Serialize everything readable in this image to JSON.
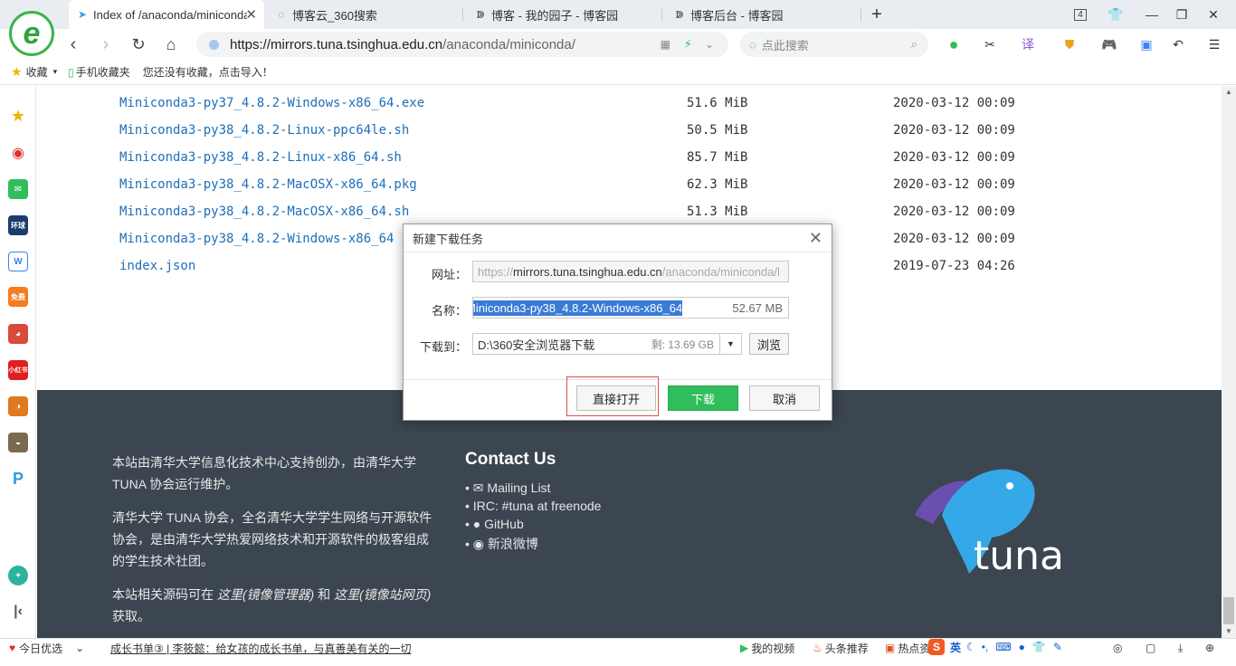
{
  "browser": {
    "tabs": [
      {
        "label": "Index of /anaconda/miniconda/",
        "active": true
      },
      {
        "label": "博客云_360搜索",
        "active": false
      },
      {
        "label": "博客 - 我的园子 - 博客园",
        "active": false
      },
      {
        "label": "博客后台 - 博客园",
        "active": false
      }
    ],
    "new_tab": "+",
    "tab_count": "4",
    "url_host": "https://mirrors.tuna.tsinghua.edu.cn",
    "url_path": "/anaconda/miniconda/",
    "search_placeholder": "点此搜索"
  },
  "bookmarks": {
    "favorites_label": "收藏",
    "mobile_label": "手机收藏夹",
    "empty_hint": "您还没有收藏，点击导入！"
  },
  "files": [
    {
      "name": "Miniconda3-py37_4.8.2-Windows-x86_64.exe",
      "size": "51.6 MiB",
      "date": "2020-03-12 00:09"
    },
    {
      "name": "Miniconda3-py38_4.8.2-Linux-ppc64le.sh",
      "size": "50.5 MiB",
      "date": "2020-03-12 00:09"
    },
    {
      "name": "Miniconda3-py38_4.8.2-Linux-x86_64.sh",
      "size": "85.7 MiB",
      "date": "2020-03-12 00:09"
    },
    {
      "name": "Miniconda3-py38_4.8.2-MacOSX-x86_64.pkg",
      "size": "62.3 MiB",
      "date": "2020-03-12 00:09"
    },
    {
      "name": "Miniconda3-py38_4.8.2-MacOSX-x86_64.sh",
      "size": "51.3 MiB",
      "date": "2020-03-12 00:09"
    },
    {
      "name": "Miniconda3-py38_4.8.2-Windows-x86_64",
      "size": "",
      "date": "2020-03-12 00:09"
    },
    {
      "name": "index.json",
      "size": "",
      "date": "2019-07-23 04:26"
    }
  ],
  "footer": {
    "para1": "本站由清华大学信息化技术中心支持创办，由清华大学 TUNA 协会运行维护。",
    "para2": "清华大学 TUNA 协会，全名清华大学学生网络与开源软件协会，是由清华大学热爱网络技术和开源软件的极客组成的学生技术社团。",
    "para3_prefix": "本站相关源码可在",
    "para3_link1": "这里(镜像管理器)",
    "para3_mid": "和",
    "para3_link2": "这里(镜像站网页)",
    "para3_suffix": "获取。",
    "contact_title": "Contact Us",
    "contacts": [
      "Mailing List",
      "IRC: #tuna at freenode",
      "GitHub",
      "新浪微博"
    ],
    "logo_text": "tuna"
  },
  "dialog": {
    "title": "新建下载任务",
    "url_label": "网址：",
    "url_value_prefix": "https://",
    "url_value_host": "mirrors.tuna.tsinghua.edu.cn",
    "url_value_path": "/anaconda/miniconda/l",
    "name_label": "名称：",
    "name_value": "Miniconda3-py38_4.8.2-Windows-x86_64",
    "name_size": "52.67 MB",
    "save_label": "下载到：",
    "save_path": "D:\\360安全浏览器下载",
    "free_space": "剩: 13.69 GB",
    "browse_button": "浏览",
    "open_button": "直接打开",
    "download_button": "下载",
    "cancel_button": "取消"
  },
  "statusbar": {
    "daily": "今日优选",
    "headline": "成长书单③ | 李筱懿：给女孩的成长书单，与真善美有关的一切",
    "video": "我的视频",
    "news": "头条推荐",
    "hot": "热点资",
    "ime": "英"
  },
  "colors": {
    "accent_green": "#2fbe5b",
    "link_blue": "#1e6fb8",
    "footer_bg": "#3c4650",
    "highlight_box": "#d9534f"
  }
}
